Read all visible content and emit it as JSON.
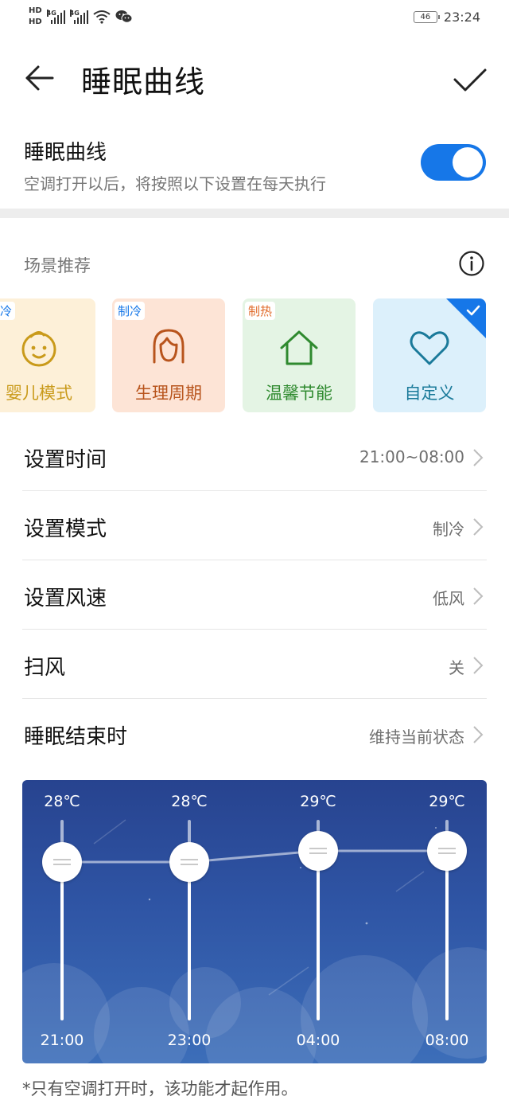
{
  "status_bar": {
    "hd1": "HD",
    "hd2": "HD",
    "sig1": "4G",
    "sig2": "4G",
    "battery": "46",
    "time": "23:24"
  },
  "app_bar": {
    "title": "睡眠曲线",
    "back_icon": "arrow-left-icon",
    "confirm_icon": "checkmark-icon"
  },
  "sleep_curve_toggle": {
    "title": "睡眠曲线",
    "subtitle": "空调打开以后，将按照以下设置在每天执行",
    "on": true,
    "color": "#1677e8"
  },
  "scenes": {
    "header": "场景推荐",
    "info_icon": "info-icon",
    "cards": [
      {
        "badge": "制冷",
        "name": "婴儿模式",
        "icon": "baby-face-icon",
        "bg": "#fdf0d8",
        "color": "#c99a1a",
        "badge_color": "#1677e8",
        "selected": false
      },
      {
        "badge": "制冷",
        "name": "生理周期",
        "icon": "woman-face-icon",
        "bg": "#fde4d6",
        "color": "#b8541c",
        "badge_color": "#1677e8",
        "selected": false
      },
      {
        "badge": "制热",
        "name": "温馨节能",
        "icon": "house-icon",
        "bg": "#e4f4e4",
        "color": "#2f8a2f",
        "badge_color": "#e06a2a",
        "selected": false
      },
      {
        "badge": "",
        "name": "自定义",
        "icon": "heart-icon",
        "bg": "#dcf0fb",
        "color": "#1a7a9a",
        "badge_color": "#1677e8",
        "selected": true
      }
    ]
  },
  "settings": [
    {
      "label": "设置时间",
      "value": "21:00~08:00"
    },
    {
      "label": "设置模式",
      "value": "制冷"
    },
    {
      "label": "设置风速",
      "value": "低风"
    },
    {
      "label": "扫风",
      "value": "关"
    },
    {
      "label": "睡眠结束时",
      "value": "维持当前状态"
    }
  ],
  "curve": {
    "points": [
      {
        "temp": "28℃",
        "time": "21:00",
        "value": 28
      },
      {
        "temp": "28℃",
        "time": "23:00",
        "value": 28
      },
      {
        "temp": "29℃",
        "time": "04:00",
        "value": 29
      },
      {
        "temp": "29℃",
        "time": "08:00",
        "value": 29
      }
    ]
  },
  "footnote": "*只有空调打开时，该功能才起作用。"
}
